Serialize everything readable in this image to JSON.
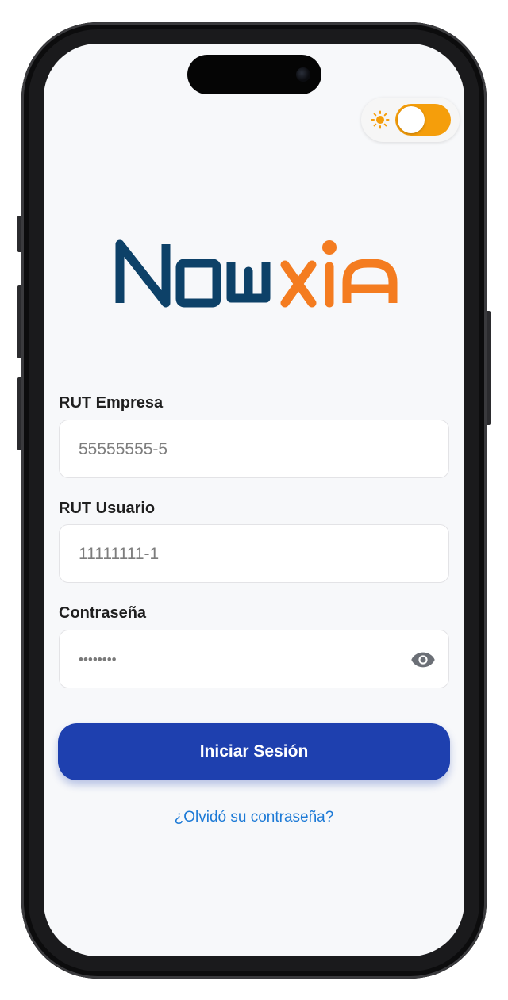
{
  "theme_toggle": {
    "icon": "sun-icon",
    "state": "on",
    "accent_color": "#f59e0b"
  },
  "logo": {
    "text_part1": "Now",
    "text_part2": "xia",
    "color1": "#0d4168",
    "color2": "#f47c20"
  },
  "form": {
    "company_rut": {
      "label": "RUT Empresa",
      "placeholder": "55555555-5",
      "value": ""
    },
    "user_rut": {
      "label": "RUT Usuario",
      "placeholder": "11111111-1",
      "value": ""
    },
    "password": {
      "label": "Contraseña",
      "value": "********"
    }
  },
  "actions": {
    "login_label": "Iniciar Sesión",
    "forgot_password": "¿Olvidó su contraseña?"
  },
  "colors": {
    "primary": "#1e40af",
    "link": "#1d7ad6"
  }
}
